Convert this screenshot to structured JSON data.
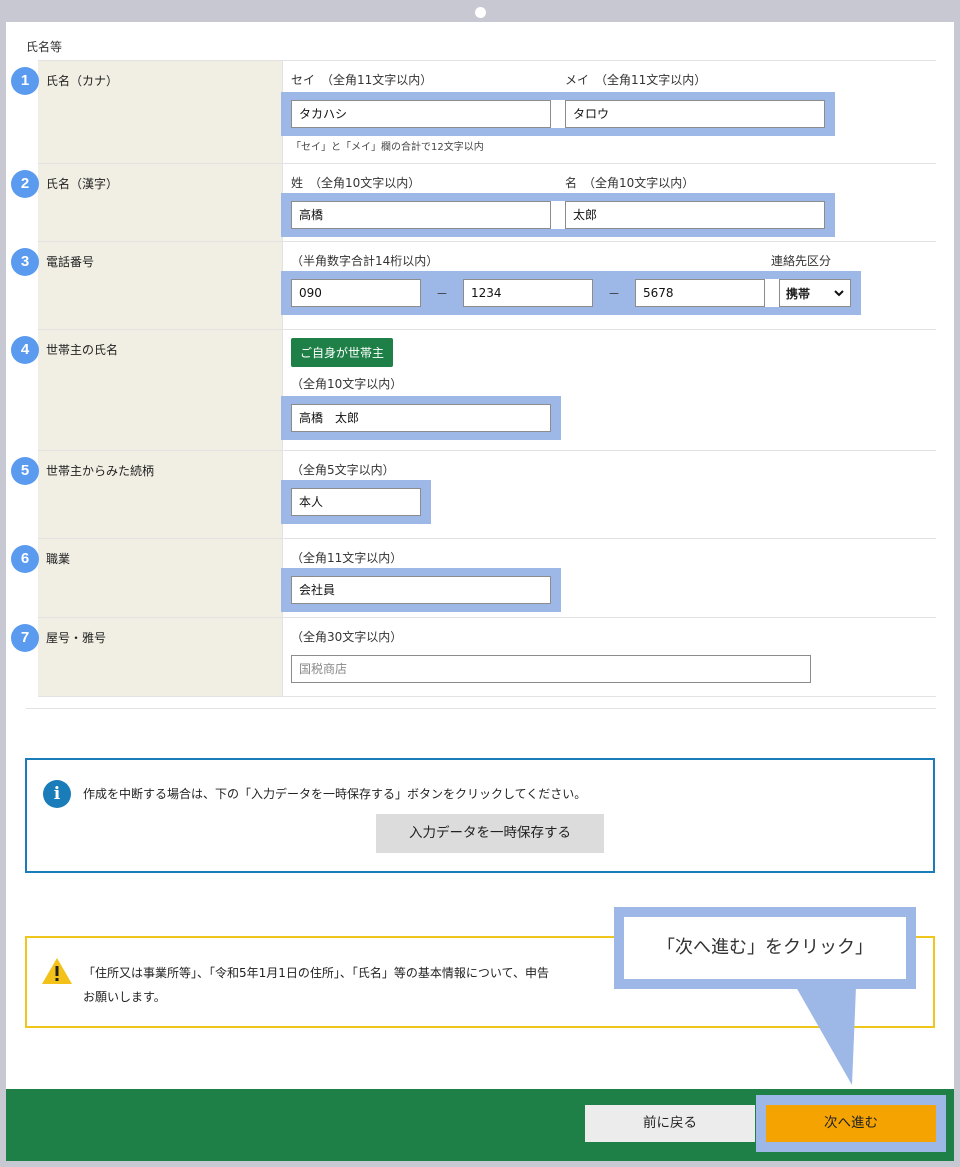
{
  "section_title": "氏名等",
  "rows": [
    {
      "num": "1",
      "label": "氏名（カナ）",
      "hint_left": "セイ　（全角11文字以内）",
      "hint_right": "メイ　（全角11文字以内）",
      "sei_value": "タカハシ",
      "mei_value": "タロウ",
      "note": "「セイ」と「メイ」欄の合計で12文字以内"
    },
    {
      "num": "2",
      "label": "氏名（漢字）",
      "hint_left": "姓　（全角10文字以内）",
      "hint_right": "名　（全角10文字以内）",
      "sei_value": "高橋",
      "mei_value": "太郎"
    },
    {
      "num": "3",
      "label": "電話番号",
      "hint_left": "（半角数字合計14桁以内）",
      "hint_right": "連絡先区分",
      "tel1": "090",
      "tel2": "1234",
      "tel3": "5678",
      "dash": "－",
      "contact_type": "携帯"
    },
    {
      "num": "4",
      "label": "世帯主の氏名",
      "button": "ご自身が世帯主",
      "hint": "（全角10文字以内）",
      "value": "高橋　太郎"
    },
    {
      "num": "5",
      "label": "世帯主からみた続柄",
      "hint": "（全角5文字以内）",
      "value": "本人"
    },
    {
      "num": "6",
      "label": "職業",
      "hint": "（全角11文字以内）",
      "value": "会社員"
    },
    {
      "num": "7",
      "label": "屋号・雅号",
      "hint": "（全角30文字以内）",
      "placeholder": "国税商店"
    }
  ],
  "info": {
    "icon": "info-icon",
    "text": "作成を中断する場合は、下の「入力データを一時保存する」ボタンをクリックしてください。",
    "save_button": "入力データを一時保存する"
  },
  "warning": {
    "icon": "warning-icon",
    "text_line1": "「住所又は事業所等」、「令和5年1月1日の住所」、「氏名」等の基本情報について、申告",
    "text_line2": "お願いします。"
  },
  "callout": {
    "text": "「次へ進む」をクリック」"
  },
  "footer": {
    "back_button": "前に戻る",
    "next_button": "次へ進む"
  },
  "colors": {
    "badge": "#5b9bef",
    "highlight": "#9db8e6",
    "green": "#1e7f47",
    "info_border": "#1a7cb8",
    "warn_border": "#efc71c",
    "next_button": "#f5a300"
  }
}
